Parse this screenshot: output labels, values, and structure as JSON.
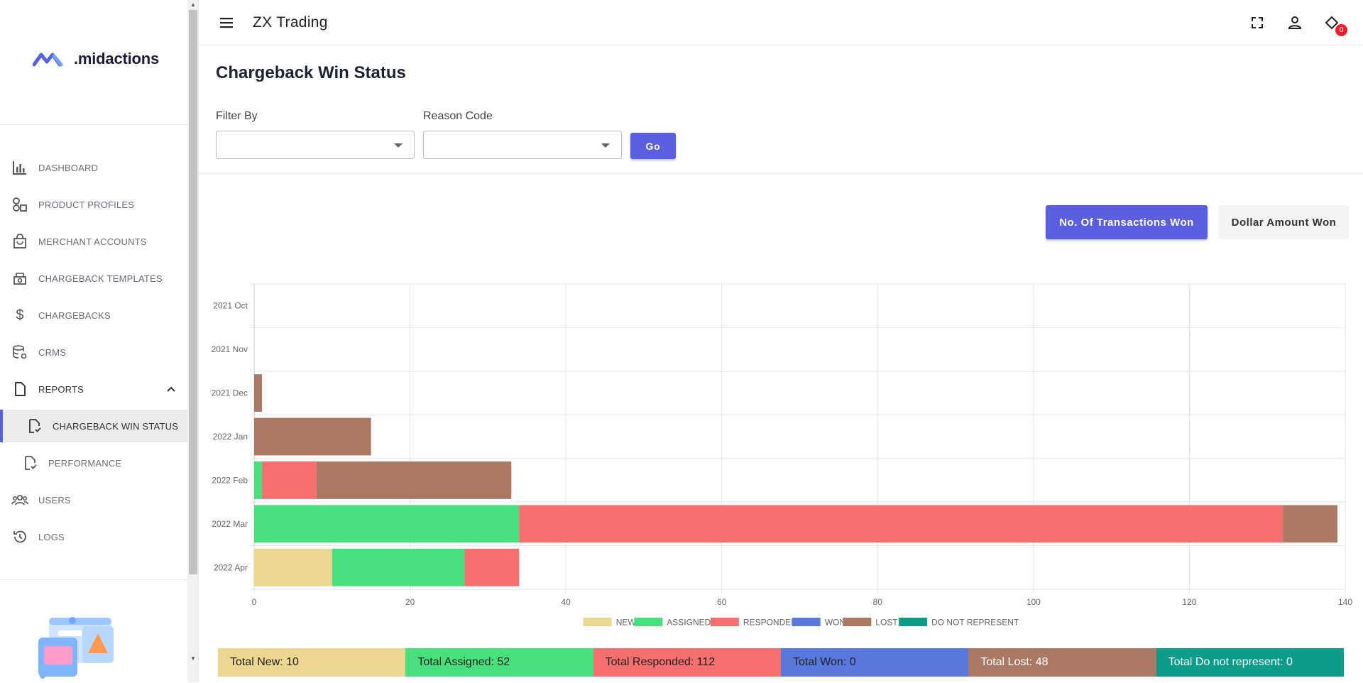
{
  "app": {
    "title": "ZX Trading"
  },
  "brand": {
    "logo_text": ".midactions",
    "accent_color": "#5a5fe0"
  },
  "sidebar": {
    "items": [
      {
        "label": "DASHBOARD",
        "icon": "bar-chart-icon"
      },
      {
        "label": "PRODUCT PROFILES",
        "icon": "shapes-icon"
      },
      {
        "label": "MERCHANT ACCOUNTS",
        "icon": "shopping-bag-icon"
      },
      {
        "label": "CHARGEBACK TEMPLATES",
        "icon": "money-stack-icon"
      },
      {
        "label": "CHARGEBACKS",
        "icon": "dollar-icon"
      },
      {
        "label": "CRMS",
        "icon": "database-settings-icon"
      },
      {
        "label": "REPORTS",
        "icon": "document-icon",
        "expanded": true
      },
      {
        "label": "CHARGEBACK WIN STATUS",
        "icon": "document-check-icon",
        "active": true
      },
      {
        "label": "PERFORMANCE",
        "icon": "document-check-icon"
      },
      {
        "label": "USERS",
        "icon": "users-icon"
      },
      {
        "label": "LOGS",
        "icon": "history-icon"
      }
    ]
  },
  "topbar": {
    "icons": [
      "menu-icon",
      "fullscreen-icon",
      "user-icon",
      "notification-icon"
    ],
    "notification_count": "0"
  },
  "page": {
    "title": "Chargeback Win Status",
    "filters": {
      "filter_by_label": "Filter By",
      "filter_by_value": "",
      "reason_code_label": "Reason Code",
      "reason_code_value": "",
      "go_label": "Go"
    },
    "toggle": {
      "transactions_label": "No. Of Transactions Won",
      "dollar_label": "Dollar Amount Won",
      "selected": "transactions"
    }
  },
  "chart_data": {
    "type": "bar",
    "orientation": "horizontal",
    "stacked": true,
    "categories": [
      "2021 Oct",
      "2021 Nov",
      "2021 Dec",
      "2022 Jan",
      "2022 Feb",
      "2022 Mar",
      "2022 Apr"
    ],
    "series": [
      {
        "name": "NEW",
        "color": "#edd68f",
        "values": [
          0,
          0,
          0,
          0,
          0,
          0,
          10
        ]
      },
      {
        "name": "ASSIGNED",
        "color": "#48df7d",
        "values": [
          0,
          0,
          0,
          0,
          1,
          34,
          17
        ]
      },
      {
        "name": "RESPONDED",
        "color": "#f56f6f",
        "values": [
          0,
          0,
          0,
          0,
          7,
          98,
          7
        ]
      },
      {
        "name": "WON",
        "color": "#5878dd",
        "values": [
          0,
          0,
          0,
          0,
          0,
          0,
          0
        ]
      },
      {
        "name": "LOST",
        "color": "#ab7864",
        "values": [
          0,
          0,
          1,
          15,
          25,
          7,
          0
        ]
      },
      {
        "name": "DO NOT REPRESENT",
        "color": "#0c9c8a",
        "values": [
          0,
          0,
          0,
          0,
          0,
          0,
          0
        ]
      }
    ],
    "xlim": [
      0,
      140
    ],
    "xticks": [
      0,
      20,
      40,
      60,
      80,
      100,
      120,
      140
    ],
    "grid": true,
    "legend": "bottom"
  },
  "totals": [
    {
      "label": "Total New: 10",
      "color": "#edd68f",
      "text_color": "#222"
    },
    {
      "label": "Total Assigned: 52",
      "color": "#48df7d",
      "text_color": "#222"
    },
    {
      "label": "Total Responded: 112",
      "color": "#f56f6f",
      "text_color": "#222"
    },
    {
      "label": "Total Won: 0",
      "color": "#5878dd",
      "text_color": "#222"
    },
    {
      "label": "Total Lost: 48",
      "color": "#ab7864",
      "text_color": "#ffffff"
    },
    {
      "label": "Total Do not represent: 0",
      "color": "#0c9c8a",
      "text_color": "#ffffff"
    }
  ]
}
